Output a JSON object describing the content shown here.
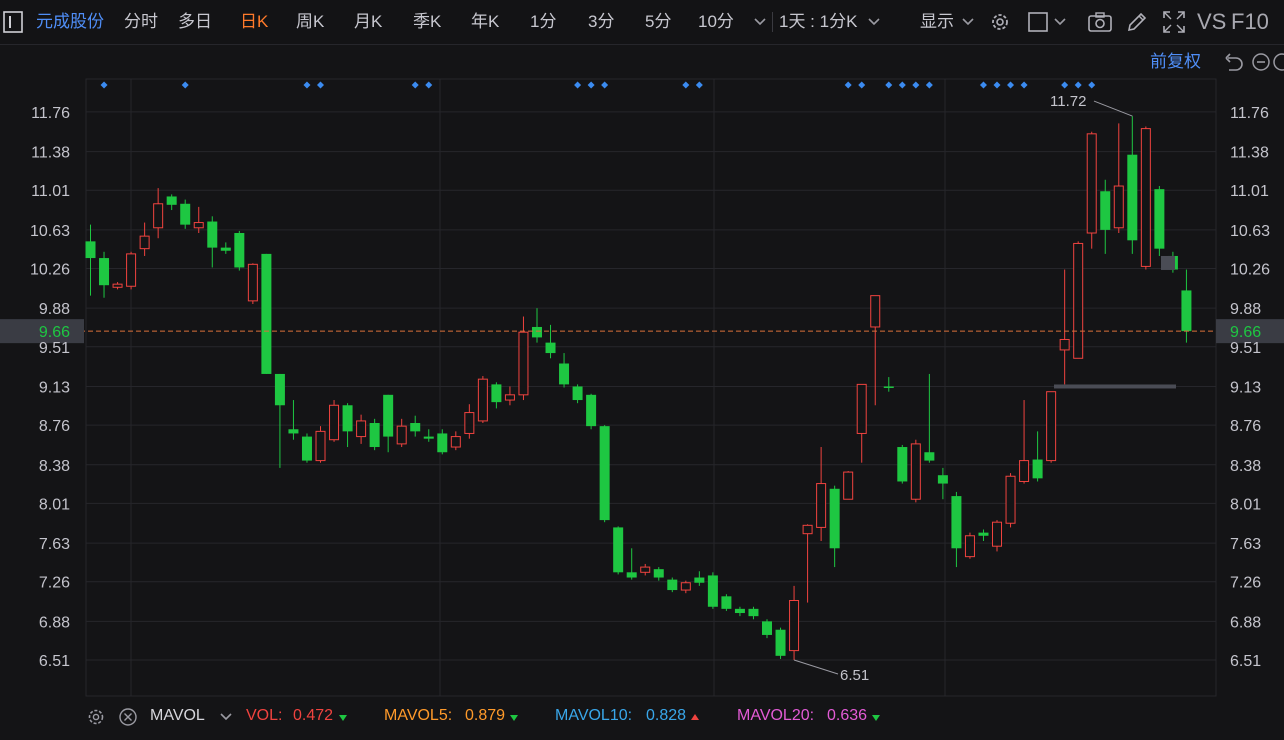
{
  "toolbar": {
    "stock_name": "元成股份",
    "tabs": [
      "分时",
      "多日",
      "日K",
      "周K",
      "月K",
      "季K",
      "年K",
      "1分",
      "3分",
      "5分"
    ],
    "active_tab": "日K",
    "interval_dropdown": "10分",
    "multi_period": "1天 : 1分K",
    "display": "显示",
    "vs_label": "VS",
    "f10_label": "F10"
  },
  "chart_options": {
    "adjust": "前复权"
  },
  "colors": {
    "up": "#f0433f",
    "down": "#1ec742",
    "accent": "#ff7a2a",
    "link": "#4f8ef7",
    "background": "#141416",
    "grid": "#26262b",
    "marker": "#3b8bf0",
    "current_line": "#d9703a"
  },
  "chart_data": {
    "type": "candlestick",
    "y_ticks": [
      "6.51",
      "6.88",
      "7.26",
      "7.63",
      "8.01",
      "8.38",
      "8.76",
      "9.13",
      "9.51",
      "9.88",
      "10.26",
      "10.63",
      "11.01",
      "11.38",
      "11.76"
    ],
    "ylim": [
      6.1,
      12.2
    ],
    "current_price": "9.66",
    "high_label": "11.72",
    "low_label": "6.51",
    "candles": [
      [
        10.52,
        10.36,
        10.68,
        10.0
      ],
      [
        10.36,
        10.1,
        10.42,
        9.98
      ],
      [
        10.08,
        10.11,
        10.13,
        10.06
      ],
      [
        10.09,
        10.4,
        10.42,
        10.06
      ],
      [
        10.45,
        10.57,
        10.7,
        10.38
      ],
      [
        10.65,
        10.88,
        11.03,
        10.55
      ],
      [
        10.95,
        10.87,
        10.97,
        10.82
      ],
      [
        10.88,
        10.68,
        10.92,
        10.64
      ],
      [
        10.65,
        10.7,
        10.85,
        10.6
      ],
      [
        10.71,
        10.46,
        10.76,
        10.27
      ],
      [
        10.46,
        10.43,
        10.51,
        10.4
      ],
      [
        10.6,
        10.27,
        10.62,
        10.24
      ],
      [
        9.95,
        10.3,
        10.31,
        9.92
      ],
      [
        10.4,
        9.25,
        10.4,
        9.25
      ],
      [
        9.25,
        8.95,
        9.25,
        8.35
      ],
      [
        8.72,
        8.68,
        9.0,
        8.62
      ],
      [
        8.65,
        8.42,
        8.68,
        8.4
      ],
      [
        8.42,
        8.7,
        8.75,
        8.4
      ],
      [
        8.62,
        8.95,
        9.0,
        8.6
      ],
      [
        8.95,
        8.7,
        8.97,
        8.55
      ],
      [
        8.65,
        8.8,
        8.86,
        8.58
      ],
      [
        8.78,
        8.55,
        8.82,
        8.52
      ],
      [
        9.05,
        8.65,
        9.05,
        8.5
      ],
      [
        8.58,
        8.75,
        8.82,
        8.55
      ],
      [
        8.78,
        8.7,
        8.85,
        8.65
      ],
      [
        8.65,
        8.63,
        8.72,
        8.6
      ],
      [
        8.68,
        8.5,
        8.72,
        8.48
      ],
      [
        8.55,
        8.65,
        8.7,
        8.52
      ],
      [
        8.68,
        8.88,
        8.96,
        8.63
      ],
      [
        8.8,
        9.2,
        9.23,
        8.78
      ],
      [
        9.15,
        8.98,
        9.17,
        8.92
      ],
      [
        9.0,
        9.05,
        9.13,
        8.95
      ],
      [
        9.05,
        9.65,
        9.8,
        9.0
      ],
      [
        9.7,
        9.6,
        9.88,
        9.55
      ],
      [
        9.55,
        9.45,
        9.72,
        9.4
      ],
      [
        9.35,
        9.15,
        9.45,
        9.12
      ],
      [
        9.13,
        9.0,
        9.15,
        8.97
      ],
      [
        9.05,
        8.75,
        9.06,
        8.72
      ],
      [
        8.75,
        7.85,
        8.76,
        7.83
      ],
      [
        7.78,
        7.35,
        7.79,
        7.33
      ],
      [
        7.35,
        7.3,
        7.58,
        7.28
      ],
      [
        7.35,
        7.4,
        7.43,
        7.32
      ],
      [
        7.38,
        7.3,
        7.4,
        7.27
      ],
      [
        7.28,
        7.18,
        7.3,
        7.16
      ],
      [
        7.18,
        7.25,
        7.27,
        7.15
      ],
      [
        7.3,
        7.25,
        7.36,
        7.22
      ],
      [
        7.32,
        7.02,
        7.35,
        7.0
      ],
      [
        7.12,
        7.0,
        7.14,
        6.98
      ],
      [
        7.0,
        6.96,
        7.02,
        6.93
      ],
      [
        7.0,
        6.93,
        7.02,
        6.9
      ],
      [
        6.88,
        6.75,
        6.9,
        6.72
      ],
      [
        6.8,
        6.55,
        6.82,
        6.52
      ],
      [
        6.6,
        7.08,
        7.22,
        6.51
      ],
      [
        7.72,
        7.8,
        7.81,
        7.06
      ],
      [
        7.78,
        8.2,
        8.55,
        7.65
      ],
      [
        8.15,
        7.58,
        8.18,
        7.4
      ],
      [
        8.05,
        8.31,
        8.32,
        8.05
      ],
      [
        8.68,
        9.15,
        9.15,
        8.4
      ],
      [
        9.7,
        10.0,
        10.0,
        8.95
      ],
      [
        9.13,
        9.12,
        9.22,
        9.08
      ],
      [
        8.55,
        8.22,
        8.57,
        8.2
      ],
      [
        8.05,
        8.58,
        8.62,
        8.02
      ],
      [
        8.5,
        8.42,
        9.25,
        8.4
      ],
      [
        8.28,
        8.2,
        8.35,
        8.05
      ],
      [
        8.08,
        7.58,
        8.12,
        7.4
      ],
      [
        7.5,
        7.7,
        7.73,
        7.48
      ],
      [
        7.73,
        7.7,
        7.76,
        7.65
      ],
      [
        7.6,
        7.83,
        7.85,
        7.55
      ],
      [
        7.82,
        8.27,
        8.3,
        7.78
      ],
      [
        8.22,
        8.42,
        9.0,
        8.2
      ],
      [
        8.43,
        8.25,
        8.7,
        8.22
      ],
      [
        8.42,
        9.08,
        9.05,
        8.4
      ],
      [
        9.48,
        9.58,
        10.25,
        9.15
      ],
      [
        9.4,
        10.5,
        10.52,
        9.4
      ],
      [
        10.6,
        11.55,
        11.57,
        10.45
      ],
      [
        11.0,
        10.63,
        11.11,
        10.4
      ],
      [
        10.65,
        11.05,
        11.65,
        10.6
      ],
      [
        11.35,
        10.53,
        11.72,
        10.4
      ],
      [
        10.28,
        11.6,
        11.62,
        10.25
      ],
      [
        11.02,
        10.45,
        11.05,
        10.38
      ],
      [
        10.38,
        10.25,
        10.42,
        10.22
      ],
      [
        10.05,
        9.66,
        10.25,
        9.55
      ]
    ],
    "signal_candle_indices": [
      1,
      7,
      16,
      17,
      24,
      25,
      36,
      37,
      38,
      44,
      45,
      56,
      57,
      59,
      60,
      61,
      62,
      66,
      67,
      68,
      69,
      72,
      73,
      74
    ]
  },
  "volume_panel": {
    "indicator": "MAVOL",
    "vol": {
      "label": "VOL:",
      "value": "0.472",
      "color": "#f0433f",
      "trend": "down"
    },
    "mavol5": {
      "label": "MAVOL5:",
      "value": "0.879",
      "color": "#ff9a2a",
      "trend": "down"
    },
    "mavol10": {
      "label": "MAVOL10:",
      "value": "0.828",
      "color": "#39a7ea",
      "trend": "up"
    },
    "mavol20": {
      "label": "MAVOL20:",
      "value": "0.636",
      "color": "#e35bd6",
      "trend": "down"
    }
  }
}
